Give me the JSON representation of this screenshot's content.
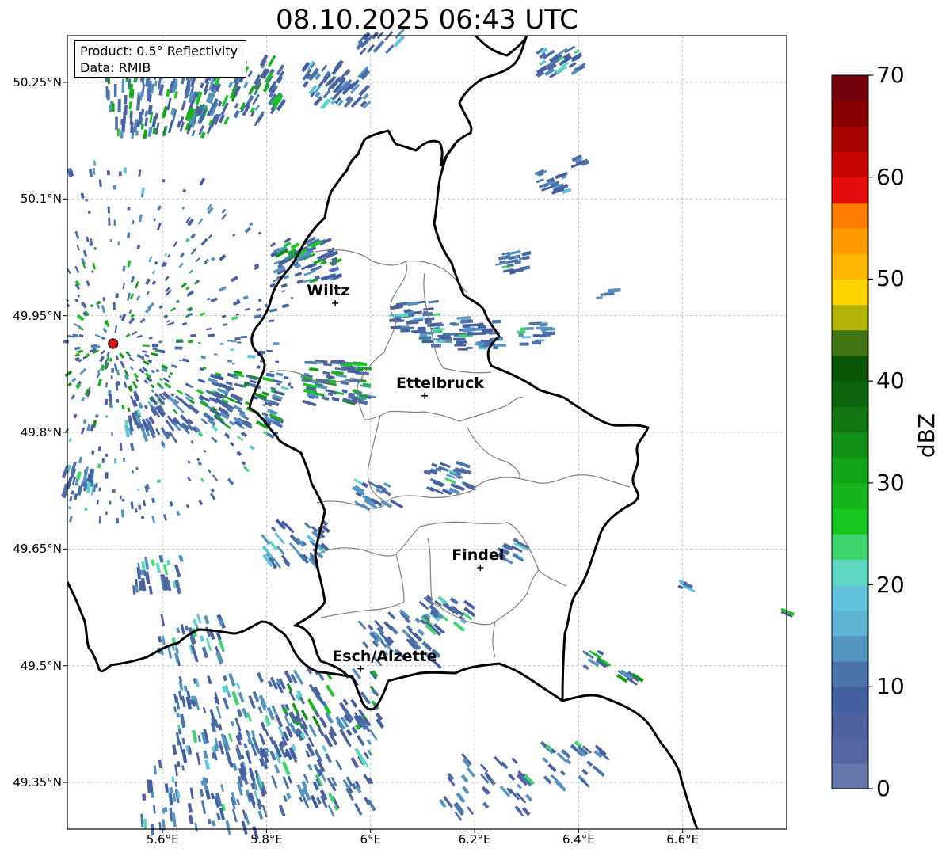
{
  "title": "08.10.2025 06:43 UTC",
  "info": {
    "product": "Product: 0.5° Reflectivity",
    "data": "Data: RMIB"
  },
  "map_extent": {
    "lon_min": 5.417,
    "lon_max": 6.8,
    "lat_min": 49.29,
    "lat_max": 50.31
  },
  "lat_ticks": [
    "50.25°N",
    "50.1°N",
    "49.95°N",
    "49.8°N",
    "49.65°N",
    "49.5°N",
    "49.35°N"
  ],
  "lat_tick_values": [
    50.25,
    50.1,
    49.95,
    49.8,
    49.65,
    49.5,
    49.35
  ],
  "lon_ticks": [
    "5.6°E",
    "5.8°E",
    "6°E",
    "6.2°E",
    "6.4°E",
    "6.6°E"
  ],
  "lon_tick_values": [
    5.6,
    5.8,
    6.0,
    6.2,
    6.4,
    6.6
  ],
  "cities": [
    {
      "name": "Wiltz",
      "lon": 5.932,
      "lat": 49.966
    },
    {
      "name": "Ettelbruck",
      "lon": 6.104,
      "lat": 49.847
    },
    {
      "name": "Findel",
      "lon": 6.211,
      "lat": 49.626
    },
    {
      "name": "Esch/Alzette",
      "lon": 5.981,
      "lat": 49.496
    }
  ],
  "radar_site": {
    "lon": 5.505,
    "lat": 49.914,
    "color": "#dd1111"
  },
  "colorbar": {
    "label": "dBZ",
    "ticks": [
      "70",
      "60",
      "50",
      "40",
      "30",
      "20",
      "10",
      "0"
    ],
    "tick_values": [
      70,
      60,
      50,
      40,
      30,
      20,
      10,
      0
    ],
    "min": 0,
    "max": 70,
    "step": 2.5,
    "colors": [
      "#6577aa",
      "#5566a3",
      "#4f62a0",
      "#445fa2",
      "#4a73aa",
      "#5494bf",
      "#5fb4d2",
      "#62c4dc",
      "#5ed7c2",
      "#3ed46e",
      "#18c620",
      "#14b41a",
      "#13a318",
      "#128f15",
      "#117612",
      "#0e640e",
      "#085508",
      "#417311",
      "#b1b306",
      "#ffd500",
      "#ffb605",
      "#ff9b00",
      "#ff7d00",
      "#e40c0c",
      "#c50404",
      "#a60202",
      "#860000",
      "#73000a",
      "#ffe0ff",
      "#ffb7ff",
      "#ff6cff",
      "#eb33eb"
    ]
  }
}
